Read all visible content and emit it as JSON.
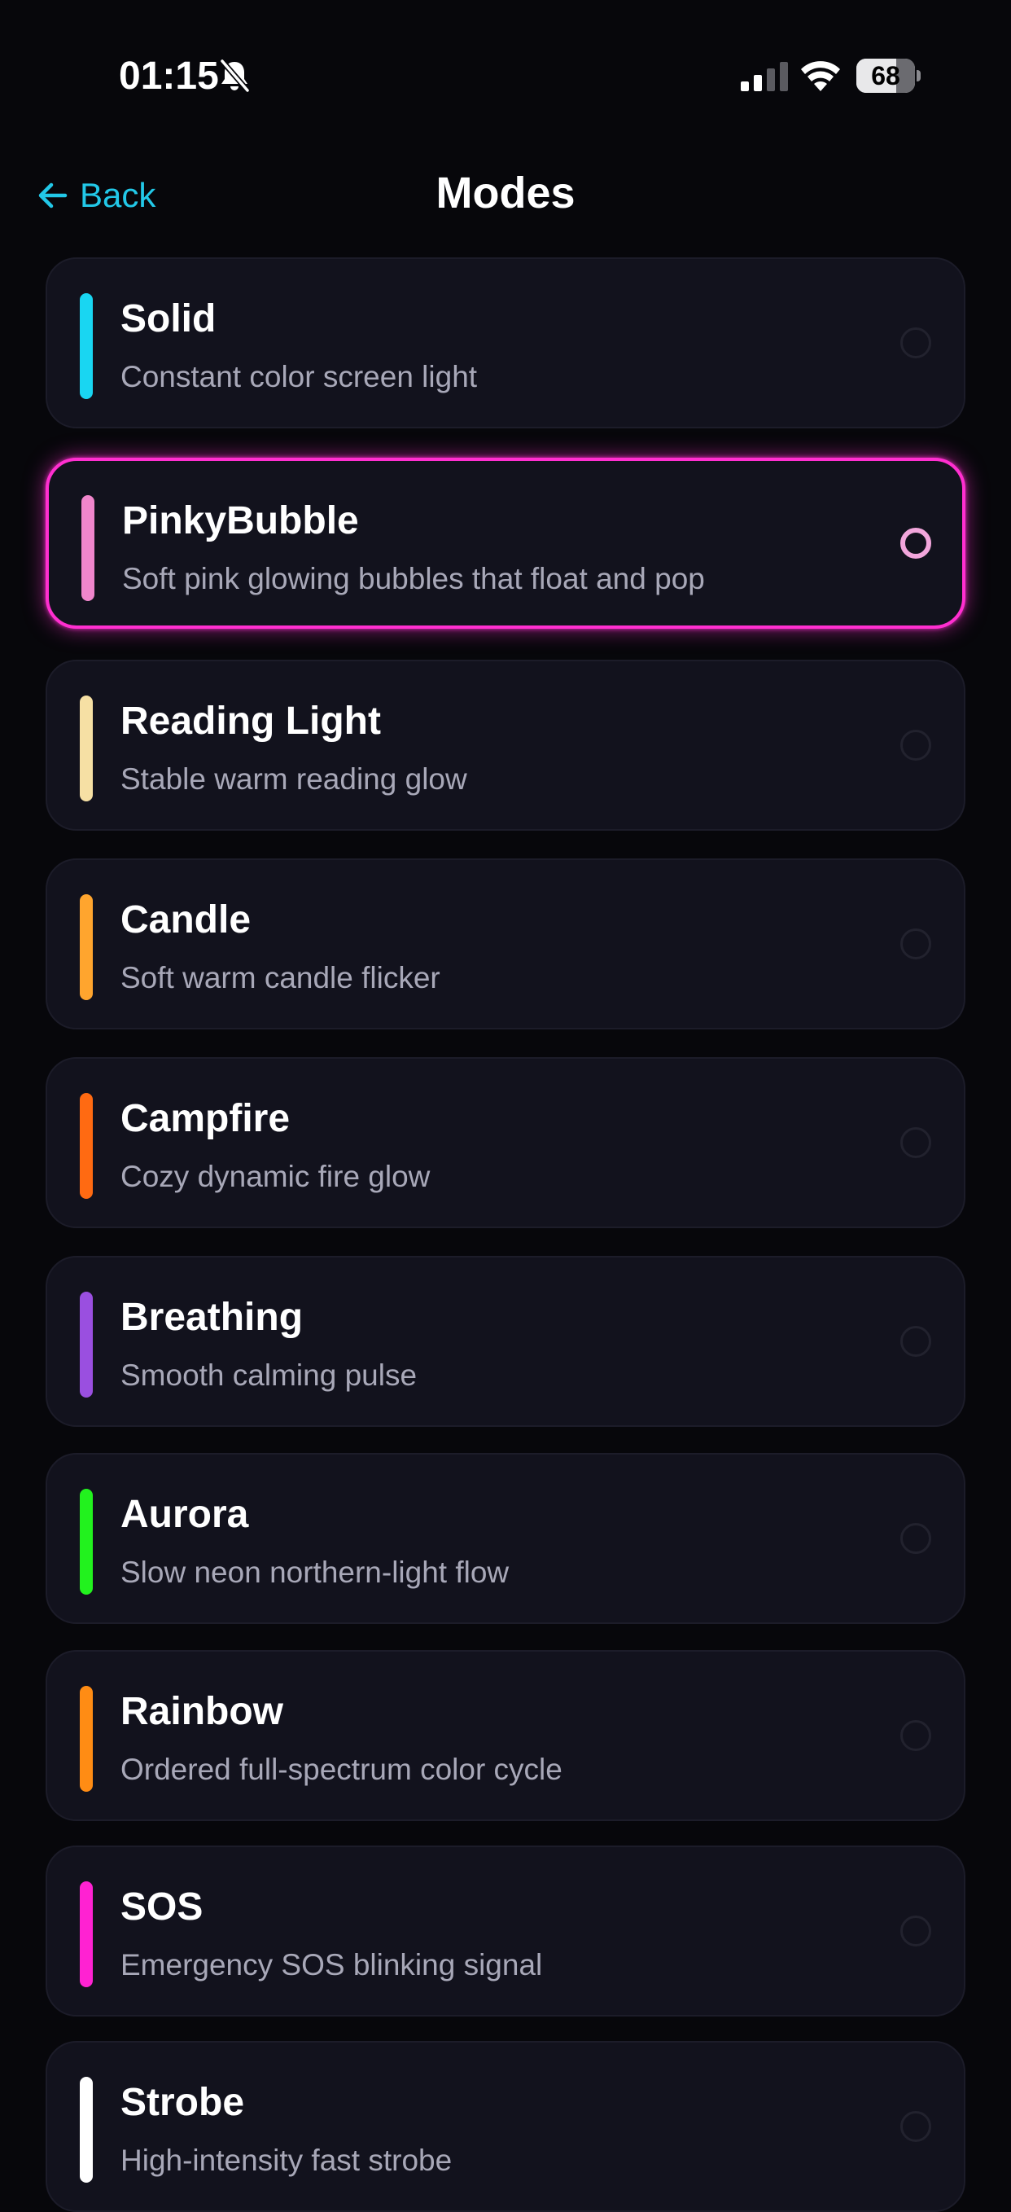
{
  "status_bar": {
    "time": "01:15",
    "battery_level": "68",
    "battery_fraction": 0.68,
    "icons": [
      "bell-slash-icon",
      "cellular-signal-icon",
      "wifi-icon",
      "battery-icon"
    ]
  },
  "nav": {
    "back_label": "Back",
    "title": "Modes"
  },
  "colors": {
    "accent": "#22c8e8",
    "selected_border": "#ff2fd0",
    "card_background": "#12121d",
    "page_background": "#07070b"
  },
  "modes": [
    {
      "name": "Solid",
      "description": "Constant color screen light",
      "color": "#19d6f2",
      "selected": false
    },
    {
      "name": "PinkyBubble",
      "description": "Soft pink glowing bubbles that float and pop",
      "color": "#f086cc",
      "selected": true
    },
    {
      "name": "Reading Light",
      "description": "Stable warm reading glow",
      "color": "#f6e0a4",
      "selected": false
    },
    {
      "name": "Candle",
      "description": "Soft warm candle flicker",
      "color": "#ffa52e",
      "selected": false
    },
    {
      "name": "Campfire",
      "description": "Cozy dynamic fire glow",
      "color": "#ff6a12",
      "selected": false
    },
    {
      "name": "Breathing",
      "description": "Smooth calming pulse",
      "color": "#9a4fe0",
      "selected": false
    },
    {
      "name": "Aurora",
      "description": "Slow neon northern-light flow",
      "color": "#22f21e",
      "selected": false
    },
    {
      "name": "Rainbow",
      "description": "Ordered full-spectrum color cycle",
      "color": "#ff8c14",
      "selected": false
    },
    {
      "name": "SOS",
      "description": "Emergency SOS blinking signal",
      "color": "#ff22d2",
      "selected": false
    },
    {
      "name": "Strobe",
      "description": "High-intensity fast strobe",
      "color": "#ffffff",
      "selected": false
    }
  ]
}
